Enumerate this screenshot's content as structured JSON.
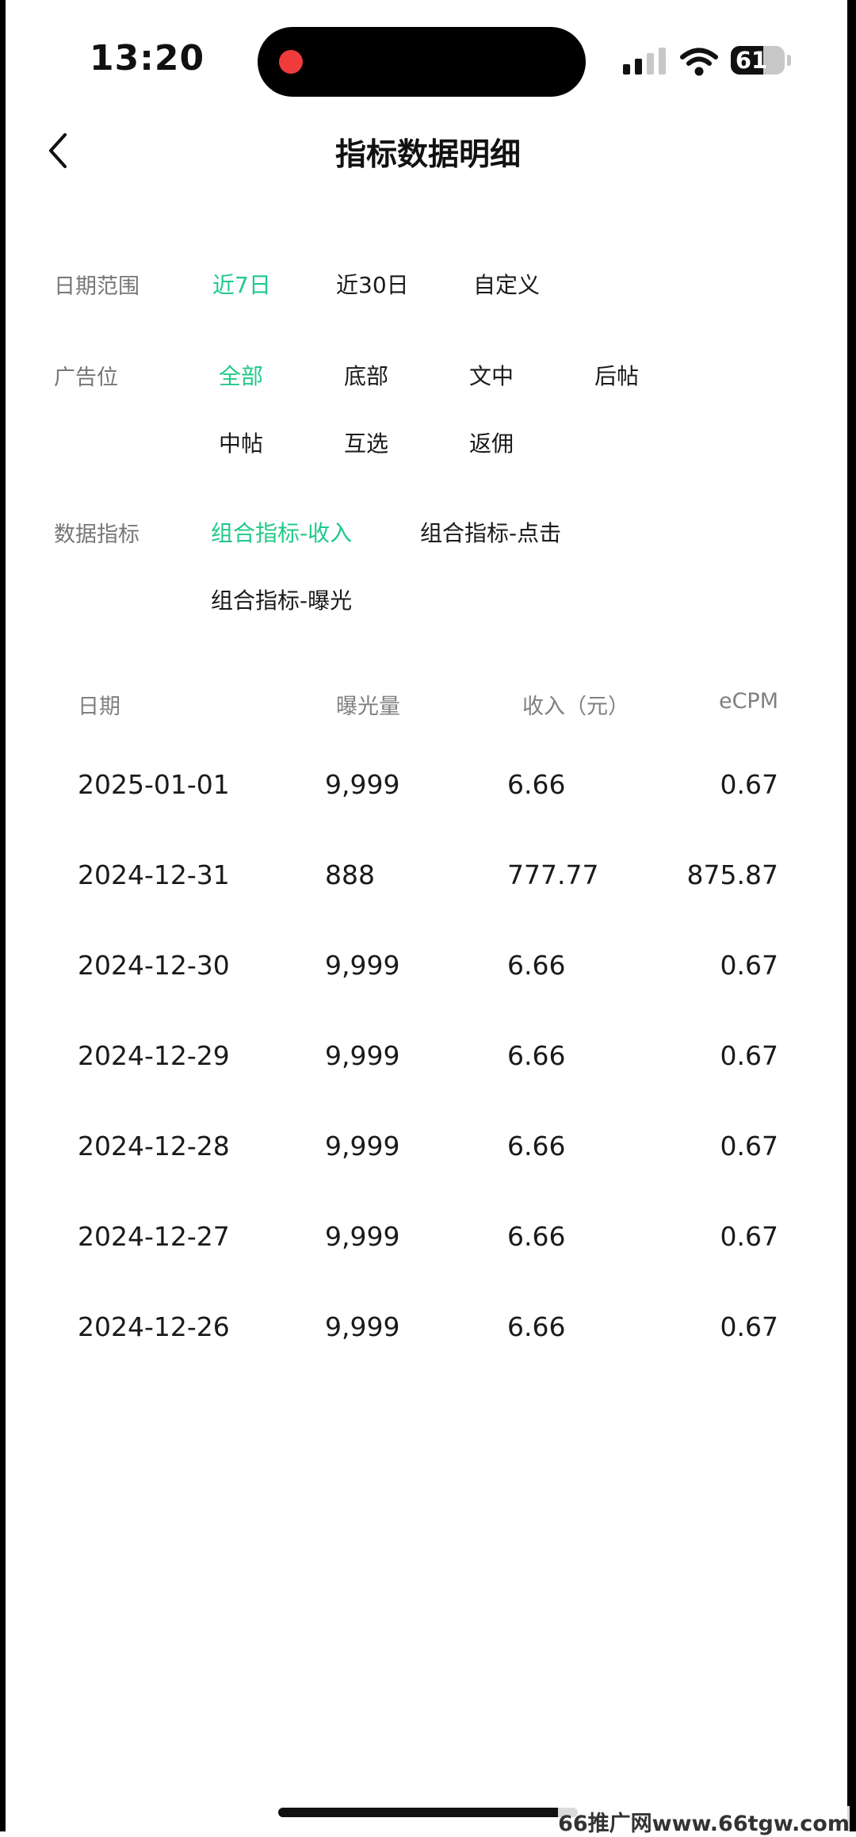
{
  "status_bar": {
    "time": "13:20",
    "battery": "61",
    "battery_level": 0.61
  },
  "nav": {
    "title": "指标数据明细"
  },
  "filters": {
    "date_range": {
      "label": "日期范围",
      "options": [
        "近7日",
        "近30日",
        "自定义"
      ],
      "selected": "近7日"
    },
    "ad_slot": {
      "label": "广告位",
      "options": [
        "全部",
        "底部",
        "文中",
        "后帖",
        "中帖",
        "互选",
        "返佣"
      ],
      "selected": "全部"
    },
    "metric": {
      "label": "数据指标",
      "options": [
        "组合指标-收入",
        "组合指标-点击",
        "组合指标-曝光"
      ],
      "selected": "组合指标-收入"
    }
  },
  "table": {
    "headers": [
      "日期",
      "曝光量",
      "收入（元）",
      "eCPM"
    ],
    "rows": [
      [
        "2025-01-01",
        "9,999",
        "6.66",
        "0.67"
      ],
      [
        "2024-12-31",
        "888",
        "777.77",
        "875.87"
      ],
      [
        "2024-12-30",
        "9,999",
        "6.66",
        "0.67"
      ],
      [
        "2024-12-29",
        "9,999",
        "6.66",
        "0.67"
      ],
      [
        "2024-12-28",
        "9,999",
        "6.66",
        "0.67"
      ],
      [
        "2024-12-27",
        "9,999",
        "6.66",
        "0.67"
      ],
      [
        "2024-12-26",
        "9,999",
        "6.66",
        "0.67"
      ]
    ]
  },
  "watermark": "66推广网www.66tgw.com",
  "colors": {
    "accent": "#21c98a",
    "record": "#ef3b3b"
  }
}
